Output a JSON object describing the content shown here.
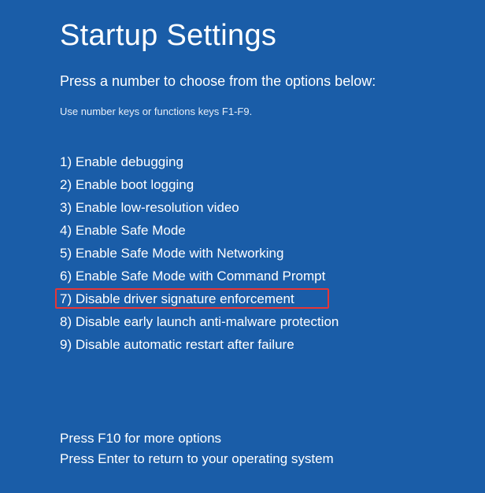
{
  "title": "Startup Settings",
  "subtitle": "Press a number to choose from the options below:",
  "instruction": "Use number keys or functions keys F1-F9.",
  "options": [
    {
      "num": "1)",
      "label": "Enable debugging"
    },
    {
      "num": "2)",
      "label": "Enable boot logging"
    },
    {
      "num": "3)",
      "label": "Enable low-resolution video"
    },
    {
      "num": "4)",
      "label": "Enable Safe Mode"
    },
    {
      "num": "5)",
      "label": "Enable Safe Mode with Networking"
    },
    {
      "num": "6)",
      "label": "Enable Safe Mode with Command Prompt"
    },
    {
      "num": "7)",
      "label": "Disable driver signature enforcement"
    },
    {
      "num": "8)",
      "label": "Disable early launch anti-malware protection"
    },
    {
      "num": "9)",
      "label": "Disable automatic restart after failure"
    }
  ],
  "highlighted_index": 6,
  "footer": {
    "line1": "Press F10 for more options",
    "line2": "Press Enter to return to your operating system"
  }
}
